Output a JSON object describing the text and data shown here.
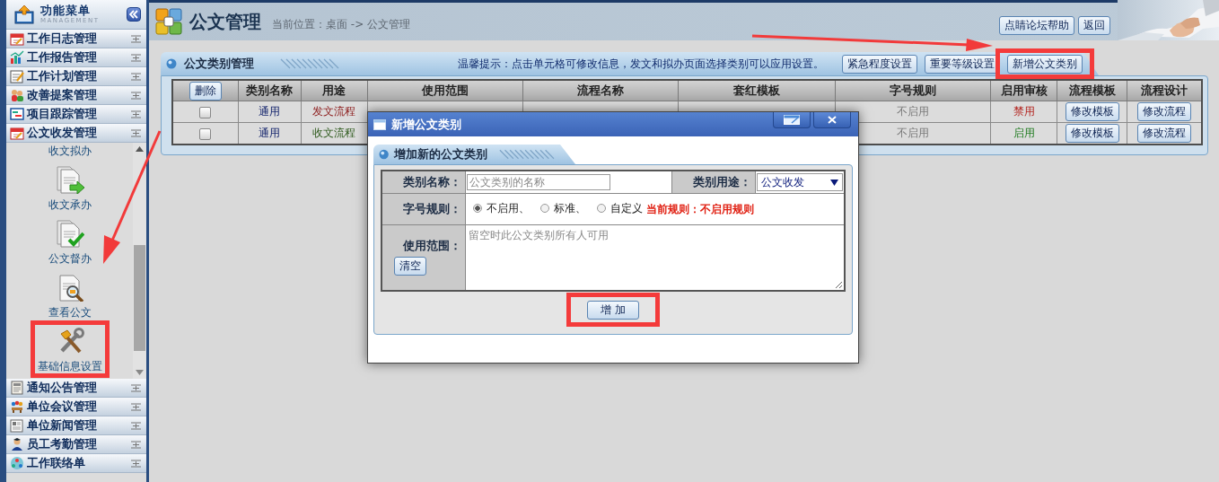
{
  "sidebar": {
    "title": "功能菜单",
    "subtitle": "MANAGEMENT",
    "groups": [
      {
        "label": "工作日志管理"
      },
      {
        "label": "工作报告管理"
      },
      {
        "label": "工作计划管理"
      },
      {
        "label": "改善提案管理"
      },
      {
        "label": "项目跟踪管理"
      },
      {
        "label": "公文收发管理",
        "items": [
          {
            "label": "收文拟办",
            "highlighted": false
          },
          {
            "label": "收文承办",
            "highlighted": false
          },
          {
            "label": "公文督办",
            "highlighted": false
          },
          {
            "label": "查看公文",
            "highlighted": false
          },
          {
            "label": "基础信息设置",
            "highlighted": true
          }
        ]
      },
      {
        "label": "通知公告管理"
      },
      {
        "label": "单位会议管理"
      },
      {
        "label": "单位新闻管理"
      },
      {
        "label": "员工考勤管理"
      },
      {
        "label": "工作联络单"
      }
    ]
  },
  "header": {
    "title": "公文管理",
    "breadcrumb": "当前位置：桌面 -> 公文管理",
    "buttons": [
      "点睛论坛帮助",
      "返回"
    ]
  },
  "panel": {
    "title": "公文类别管理",
    "tip": "温馨提示：点击单元格可修改信息，发文和拟办页面选择类别可以应用设置。",
    "buttons": [
      {
        "label": "紧急程度设置",
        "highlighted": false
      },
      {
        "label": "重要等级设置",
        "highlighted": false
      },
      {
        "label": "新增公文类别",
        "highlighted": true
      }
    ],
    "table": {
      "delete_button": "删除",
      "columns": [
        "类别名称",
        "用途",
        "使用范围",
        "流程名称",
        "套红模板",
        "字号规则",
        "启用审核",
        "流程模板",
        "流程设计"
      ],
      "rows": [
        {
          "checked": false,
          "name": "通用",
          "purpose": {
            "text": "发文流程",
            "kind": "outgoing"
          },
          "rule": "不启用",
          "review": {
            "text": "禁用",
            "on": false
          },
          "buttons": [
            "修改模板",
            "修改流程"
          ]
        },
        {
          "checked": false,
          "name": "通用",
          "purpose": {
            "text": "收文流程",
            "kind": "incoming"
          },
          "rule": "不启用",
          "review": {
            "text": "启用",
            "on": true
          },
          "buttons": [
            "修改模板",
            "修改流程"
          ]
        }
      ]
    }
  },
  "dialog": {
    "title": "新增公文类别",
    "panel_title": "增加新的公文类别",
    "name_field": {
      "label": "类别名称：",
      "placeholder": "公文类别的名称"
    },
    "use_field": {
      "label": "类别用途：",
      "value": "公文收发"
    },
    "rule_field": {
      "label": "字号规则：",
      "options": [
        {
          "label": "不启用、",
          "selected": true
        },
        {
          "label": "标准、",
          "selected": false
        },
        {
          "label": "自定义",
          "selected": false
        }
      ],
      "current": "当前规则：不启用规则"
    },
    "scope_field": {
      "label": "使用范围：",
      "placeholder": "留空时此公文类别所有人可用",
      "clear_button": "清空"
    },
    "submit": {
      "label": "增 加",
      "highlighted": true
    }
  },
  "annotations": {
    "arrows": true
  }
}
